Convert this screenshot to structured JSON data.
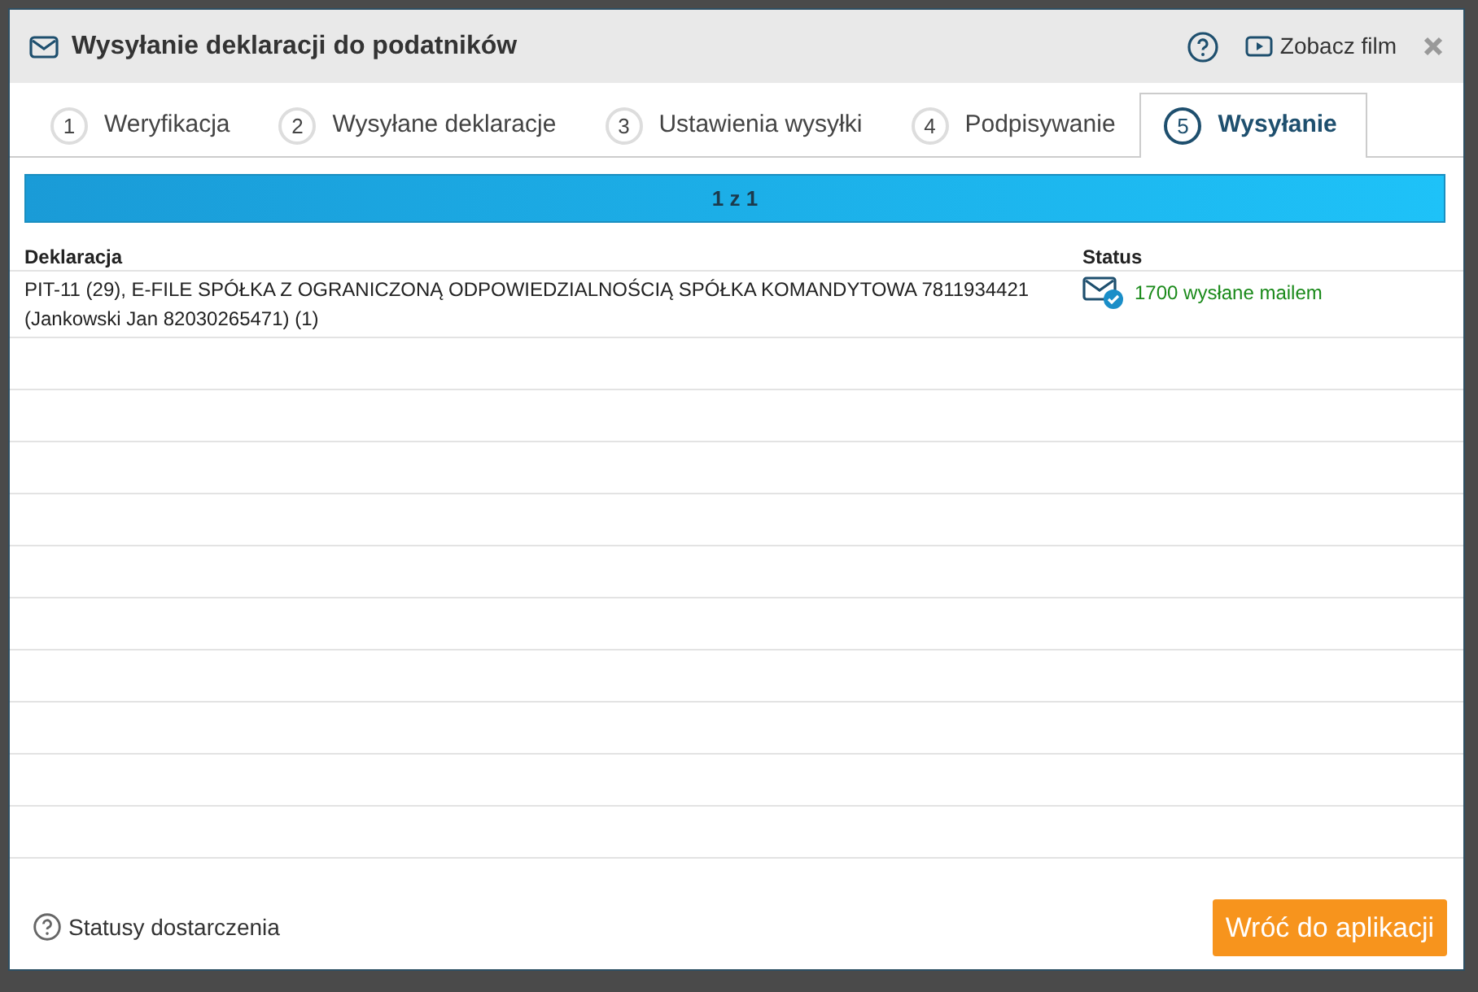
{
  "dialog": {
    "title": "Wysyłanie deklaracji do podatników",
    "video_link": "Zobacz film"
  },
  "tabs": [
    {
      "number": "1",
      "label": "Weryfikacja",
      "selected": false
    },
    {
      "number": "2",
      "label": "Wysyłane deklaracje",
      "selected": false
    },
    {
      "number": "3",
      "label": "Ustawienia wysyłki",
      "selected": false
    },
    {
      "number": "4",
      "label": "Podpisywanie",
      "selected": false
    },
    {
      "number": "5",
      "label": "Wysyłanie",
      "selected": true
    }
  ],
  "progress": {
    "label": "1 z 1",
    "level": 1
  },
  "table": {
    "columns": [
      "Deklaracja",
      "Status"
    ],
    "rows": [
      {
        "declaration": "PIT-11 (29), E-FILE SPÓŁKA Z OGRANICZONĄ ODPOWIEDZIALNOŚCIĄ SPÓŁKA KOMANDYTOWA 7811934421 (Jankowski Jan 82030265471) (1)",
        "status": "1700 wysłane mailem",
        "kind": "sent"
      }
    ]
  },
  "footer": {
    "help_link": "Statusy dostarczenia",
    "button": "Wróć do aplikacji"
  }
}
